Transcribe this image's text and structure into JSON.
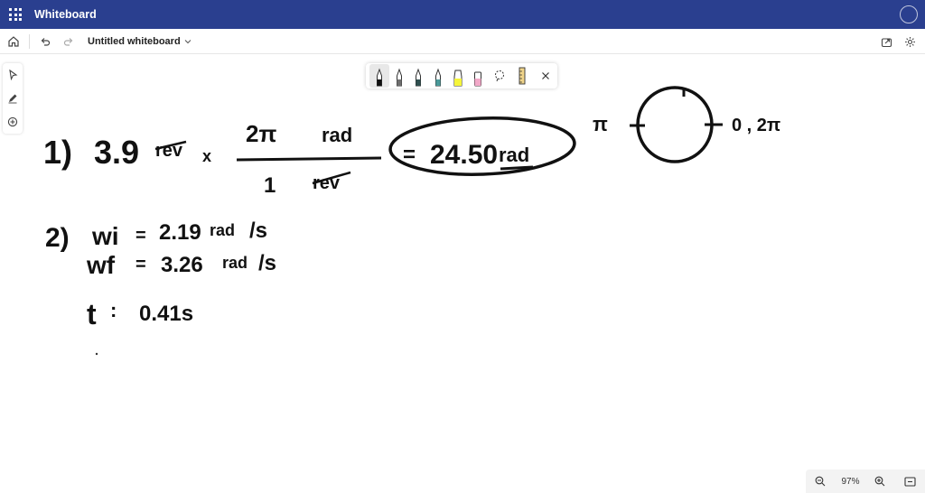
{
  "titlebar": {
    "app_name": "Whiteboard"
  },
  "command_bar": {
    "document_title": "Untitled whiteboard"
  },
  "pen_toolbar": {
    "pens": [
      {
        "name": "black-pen",
        "color": "#111111"
      },
      {
        "name": "gray-pen",
        "color": "#6e6e6e"
      },
      {
        "name": "dark-teal-pen",
        "color": "#2f4f4f"
      },
      {
        "name": "light-teal-pen",
        "color": "#4a9a9a"
      },
      {
        "name": "yellow-highlighter",
        "color": "#f5f53a"
      },
      {
        "name": "pink-highlighter",
        "color": "#f2a8c8"
      }
    ]
  },
  "canvas": {
    "ink": [
      "1)",
      "3.9",
      "rev",
      "x",
      "2π",
      "rad",
      "1",
      "rev",
      "=",
      "24.50",
      "rad",
      "π",
      "0 , 2π",
      "2)",
      "wi",
      "=",
      "2.19",
      "rad",
      "/s",
      "wf",
      "=",
      "3.26",
      "rad",
      "/s",
      "t",
      ":",
      "0.41s"
    ]
  },
  "zoom": {
    "level": "97%"
  }
}
